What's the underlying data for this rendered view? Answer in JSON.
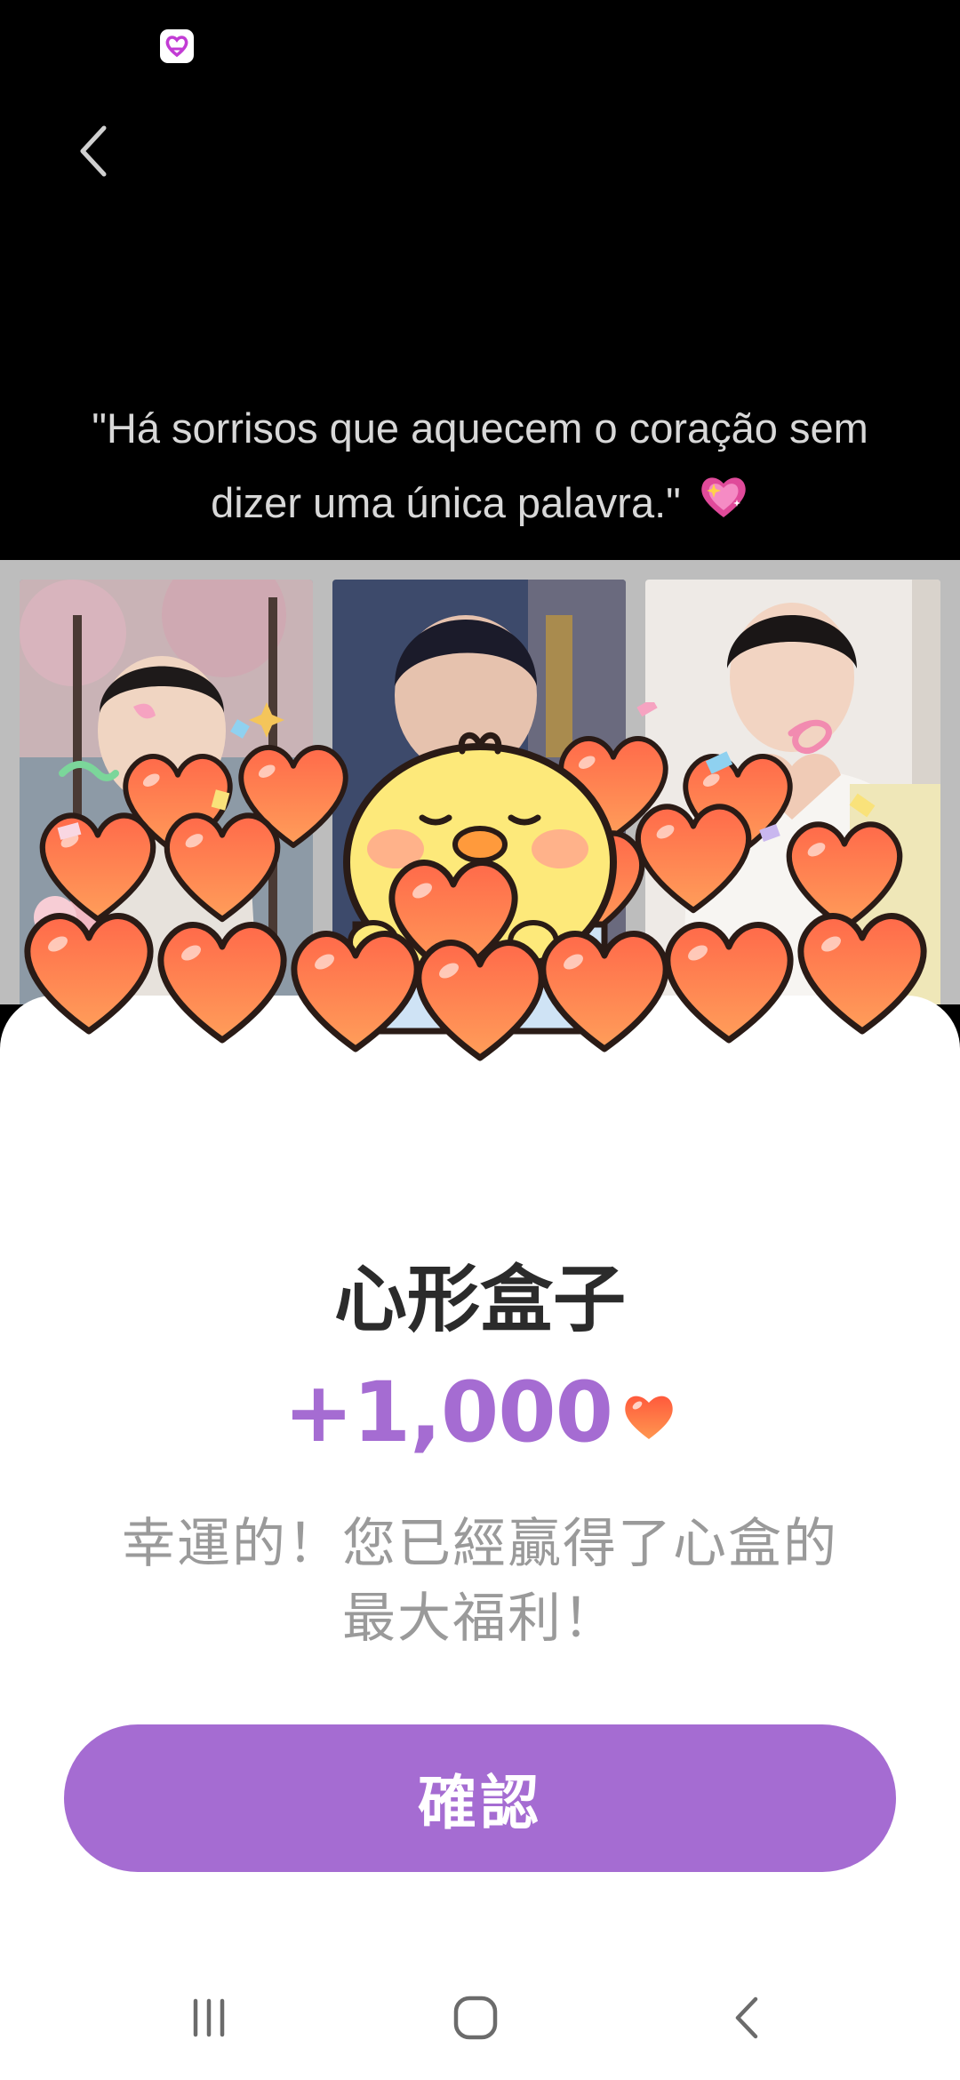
{
  "status_bar": {
    "app_icon": "heart-app-icon"
  },
  "video": {
    "caption_line1": "\"Há sorrisos que aquecem o coração sem",
    "caption_line2": "dizer uma única palavra.\"",
    "caption_emoji": "sparkling-heart-icon"
  },
  "reward_dialog": {
    "title": "心形盒子",
    "amount": "+1,000",
    "currency_icon": "heart-icon",
    "message_line1": "幸運的！您已經贏得了心盒的",
    "message_line2": "最大福利！",
    "confirm_label": "確認",
    "accent_color": "#a56cd2"
  },
  "system_nav": {
    "recents_icon": "recents-icon",
    "home_icon": "home-icon",
    "back_icon": "back-icon"
  }
}
